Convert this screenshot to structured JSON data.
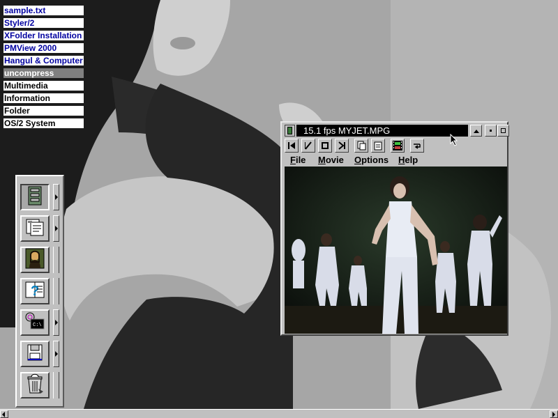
{
  "desktop": {
    "objects": [
      {
        "label": "sample.txt",
        "style": "blue"
      },
      {
        "label": "Styler/2",
        "style": "blue"
      },
      {
        "label": "XFolder Installation",
        "style": "blue"
      },
      {
        "label": "PMView 2000",
        "style": "blue"
      },
      {
        "label": "Hangul & Computer",
        "style": "blue"
      },
      {
        "label": "uncompress",
        "style": "selected"
      },
      {
        "label": "Multimedia",
        "style": "black"
      },
      {
        "label": "Information",
        "style": "black"
      },
      {
        "label": "Folder",
        "style": "black"
      },
      {
        "label": "OS/2 System",
        "style": "black"
      }
    ],
    "wallpaper": "grayscale photo of a woman with long dark hair in a sleeveless top"
  },
  "launchpad": {
    "buttons": [
      {
        "icon": "drives-icon",
        "has_drawer": true
      },
      {
        "icon": "templates-icon",
        "has_drawer": true
      },
      {
        "icon": "mona-lisa-icon",
        "has_drawer": false
      },
      {
        "icon": "help-icon",
        "has_drawer": false
      },
      {
        "icon": "command-prompt-icon",
        "has_drawer": true
      },
      {
        "icon": "floppy-disk-icon",
        "has_drawer": true
      },
      {
        "icon": "shredder-icon",
        "has_drawer": false
      }
    ]
  },
  "player": {
    "title": "15.1 fps MYJET.MPG",
    "menus": [
      {
        "mnemonic": "F",
        "rest": "ile"
      },
      {
        "mnemonic": "M",
        "rest": "ovie"
      },
      {
        "mnemonic": "O",
        "rest": "ptions"
      },
      {
        "mnemonic": "H",
        "rest": "elp"
      }
    ],
    "toolbar": [
      "rewind-icon",
      "play-icon",
      "stop-icon",
      "step-forward-icon",
      "copy-icon",
      "paste-icon",
      "filmstrip-icon",
      "loop-icon"
    ],
    "video_description": "dancers in white outfits performing on a dark stage"
  },
  "colors": {
    "desktop_label_blue": "#0000a0",
    "selected_label_bg": "#808080",
    "title_bar": "#000000",
    "frame": "#c0c0c0"
  }
}
